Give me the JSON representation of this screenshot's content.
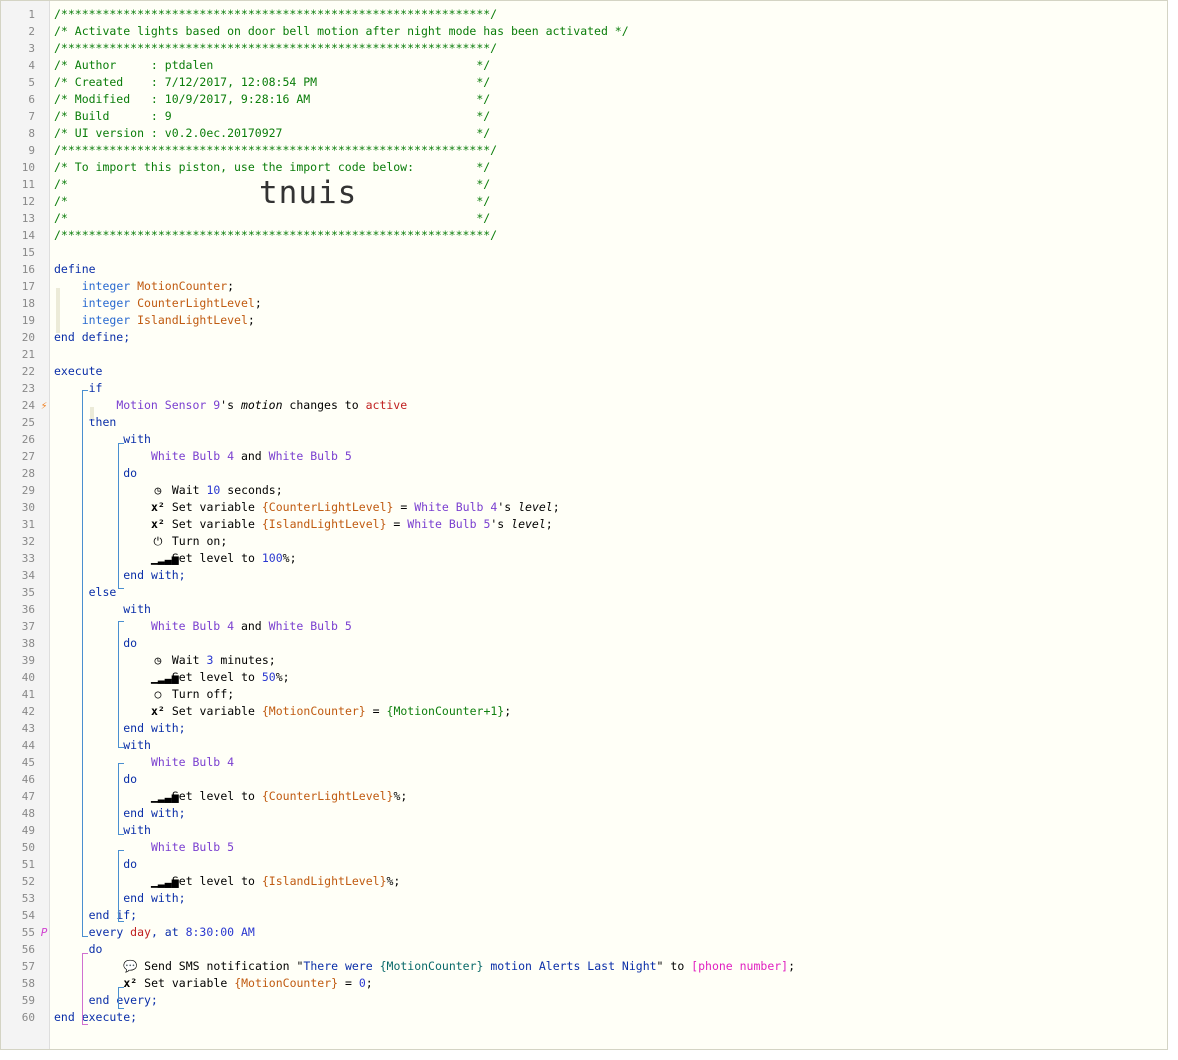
{
  "lines": [
    {
      "n": "1",
      "html": "<span class='c-comment'>/**************************************************************/</span>"
    },
    {
      "n": "2",
      "html": "<span class='c-comment'>/* Activate lights based on door bell motion after night mode has been activated */</span>"
    },
    {
      "n": "3",
      "html": "<span class='c-comment'>/**************************************************************/</span>"
    },
    {
      "n": "4",
      "html": "<span class='c-comment'>/* Author     : ptdalen                                      */</span>"
    },
    {
      "n": "5",
      "html": "<span class='c-comment'>/* Created    : 7/12/2017, 12:08:54 PM                       */</span>"
    },
    {
      "n": "6",
      "html": "<span class='c-comment'>/* Modified   : 10/9/2017, 9:28:16 AM                        */</span>"
    },
    {
      "n": "7",
      "html": "<span class='c-comment'>/* Build      : 9                                            */</span>"
    },
    {
      "n": "8",
      "html": "<span class='c-comment'>/* UI version : v0.2.0ec.20170927                            */</span>"
    },
    {
      "n": "9",
      "html": "<span class='c-comment'>/**************************************************************/</span>"
    },
    {
      "n": "10",
      "html": "<span class='c-comment'>/* To import this piston, use the import code below:         */</span>"
    },
    {
      "n": "11",
      "html": "<span class='c-comment'>/*                                                           */</span>"
    },
    {
      "n": "12",
      "html": "<span class='c-comment'>/*                                                           */</span><span class='big'>tnuis</span>"
    },
    {
      "n": "13",
      "html": "<span class='c-comment'>/*                                                           */</span>"
    },
    {
      "n": "14",
      "html": "<span class='c-comment'>/**************************************************************/</span>"
    },
    {
      "n": "15",
      "html": ""
    },
    {
      "n": "16",
      "html": "<span class='c-kw'>define</span>"
    },
    {
      "n": "17",
      "html": "    <span class='c-type'>integer</span> <span class='c-var'>MotionCounter</span>;"
    },
    {
      "n": "18",
      "html": "    <span class='c-type'>integer</span> <span class='c-var'>CounterLightLevel</span>;"
    },
    {
      "n": "19",
      "html": "    <span class='c-type'>integer</span> <span class='c-var'>IslandLightLevel</span>;"
    },
    {
      "n": "20",
      "html": "<span class='c-kw'>end define;</span>"
    },
    {
      "n": "21",
      "html": ""
    },
    {
      "n": "22",
      "html": "<span class='c-kw'>execute</span>"
    },
    {
      "n": "23",
      "html": "     <span class='c-kw'>if</span>"
    },
    {
      "n": "24",
      "mark": "bolt",
      "html": "         <span class='c-dev'>Motion Sensor 9</span>'s <span class='c-it'>motion</span> changes to <span class='c-red'>active</span>"
    },
    {
      "n": "25",
      "html": "     <span class='c-kw'>then</span>"
    },
    {
      "n": "26",
      "html": "          <span class='c-kw'>with</span>"
    },
    {
      "n": "27",
      "html": "              <span class='c-dev'>White Bulb 4</span> and <span class='c-dev'>White Bulb 5</span>"
    },
    {
      "n": "28",
      "html": "          <span class='c-kw'>do</span>"
    },
    {
      "n": "29",
      "html": "              <span class='ico'>◷</span> Wait <span class='c-num'>10</span> seconds;"
    },
    {
      "n": "30",
      "html": "              <span class='ico'><b>x²</b></span> Set variable <span class='c-var'>{CounterLightLevel}</span> = <span class='c-dev'>White Bulb 4</span>'s <span class='c-it'>level</span>;"
    },
    {
      "n": "31",
      "html": "              <span class='ico'><b>x²</b></span> Set variable <span class='c-var'>{IslandLightLevel}</span> = <span class='c-dev'>White Bulb 5</span>'s <span class='c-it'>level</span>;"
    },
    {
      "n": "32",
      "html": "              <span class='ico'>⏻</span> Turn on;"
    },
    {
      "n": "33",
      "html": "              <span class='ico'>▁▂▃▅</span> Set level to <span class='c-num'>100</span>%;"
    },
    {
      "n": "34",
      "html": "          <span class='c-kw'>end with;</span>"
    },
    {
      "n": "35",
      "html": "     <span class='c-kw'>else</span>"
    },
    {
      "n": "36",
      "html": "          <span class='c-kw'>with</span>"
    },
    {
      "n": "37",
      "html": "              <span class='c-dev'>White Bulb 4</span> and <span class='c-dev'>White Bulb 5</span>"
    },
    {
      "n": "38",
      "html": "          <span class='c-kw'>do</span>"
    },
    {
      "n": "39",
      "html": "              <span class='ico'>◷</span> Wait <span class='c-num'>3</span> minutes;"
    },
    {
      "n": "40",
      "html": "              <span class='ico'>▁▂▃▅</span> Set level to <span class='c-num'>50</span>%;"
    },
    {
      "n": "41",
      "html": "              <span class='ico'>○</span> Turn off;"
    },
    {
      "n": "42",
      "html": "              <span class='ico'><b>x²</b></span> Set variable <span class='c-var'>{MotionCounter}</span> = <span class='c-green'>{MotionCounter+1}</span>;"
    },
    {
      "n": "43",
      "html": "          <span class='c-kw'>end with;</span>"
    },
    {
      "n": "44",
      "html": "          <span class='c-kw'>with</span>"
    },
    {
      "n": "45",
      "html": "              <span class='c-dev'>White Bulb 4</span>"
    },
    {
      "n": "46",
      "html": "          <span class='c-kw'>do</span>"
    },
    {
      "n": "47",
      "html": "              <span class='ico'>▁▂▃▅</span> Set level to <span class='c-var'>{CounterLightLevel}</span>%;"
    },
    {
      "n": "48",
      "html": "          <span class='c-kw'>end with;</span>"
    },
    {
      "n": "49",
      "html": "          <span class='c-kw'>with</span>"
    },
    {
      "n": "50",
      "html": "              <span class='c-dev'>White Bulb 5</span>"
    },
    {
      "n": "51",
      "html": "          <span class='c-kw'>do</span>"
    },
    {
      "n": "52",
      "html": "              <span class='ico'>▁▂▃▅</span> Set level to <span class='c-var'>{IslandLightLevel}</span>%;"
    },
    {
      "n": "53",
      "html": "          <span class='c-kw'>end with;</span>"
    },
    {
      "n": "54",
      "html": "     <span class='c-kw'>end if;</span>"
    },
    {
      "n": "55",
      "mark": "p",
      "html": "     <span class='c-kw'>every <span class='c-red'>day</span>, at <span class='c-num'>8:30:00 AM</span></span>"
    },
    {
      "n": "56",
      "html": "     <span class='c-kw'>do</span>"
    },
    {
      "n": "57",
      "html": "          <span class='ico'>💬</span> Send SMS notification \"<span class='c-str'>There were </span><span class='c-str-var'>{MotionCounter}</span><span class='c-str'> motion Alerts Last Night</span>\" to <span class='c-pink'>[phone number]</span>;"
    },
    {
      "n": "58",
      "html": "          <span class='ico'><b>x²</b></span> Set variable <span class='c-var'>{MotionCounter}</span> = <span class='c-num'>0</span>;"
    },
    {
      "n": "59",
      "html": "     <span class='c-kw'>end every;</span>"
    },
    {
      "n": "60",
      "html": "<span class='c-kw'>end execute;</span>"
    }
  ]
}
